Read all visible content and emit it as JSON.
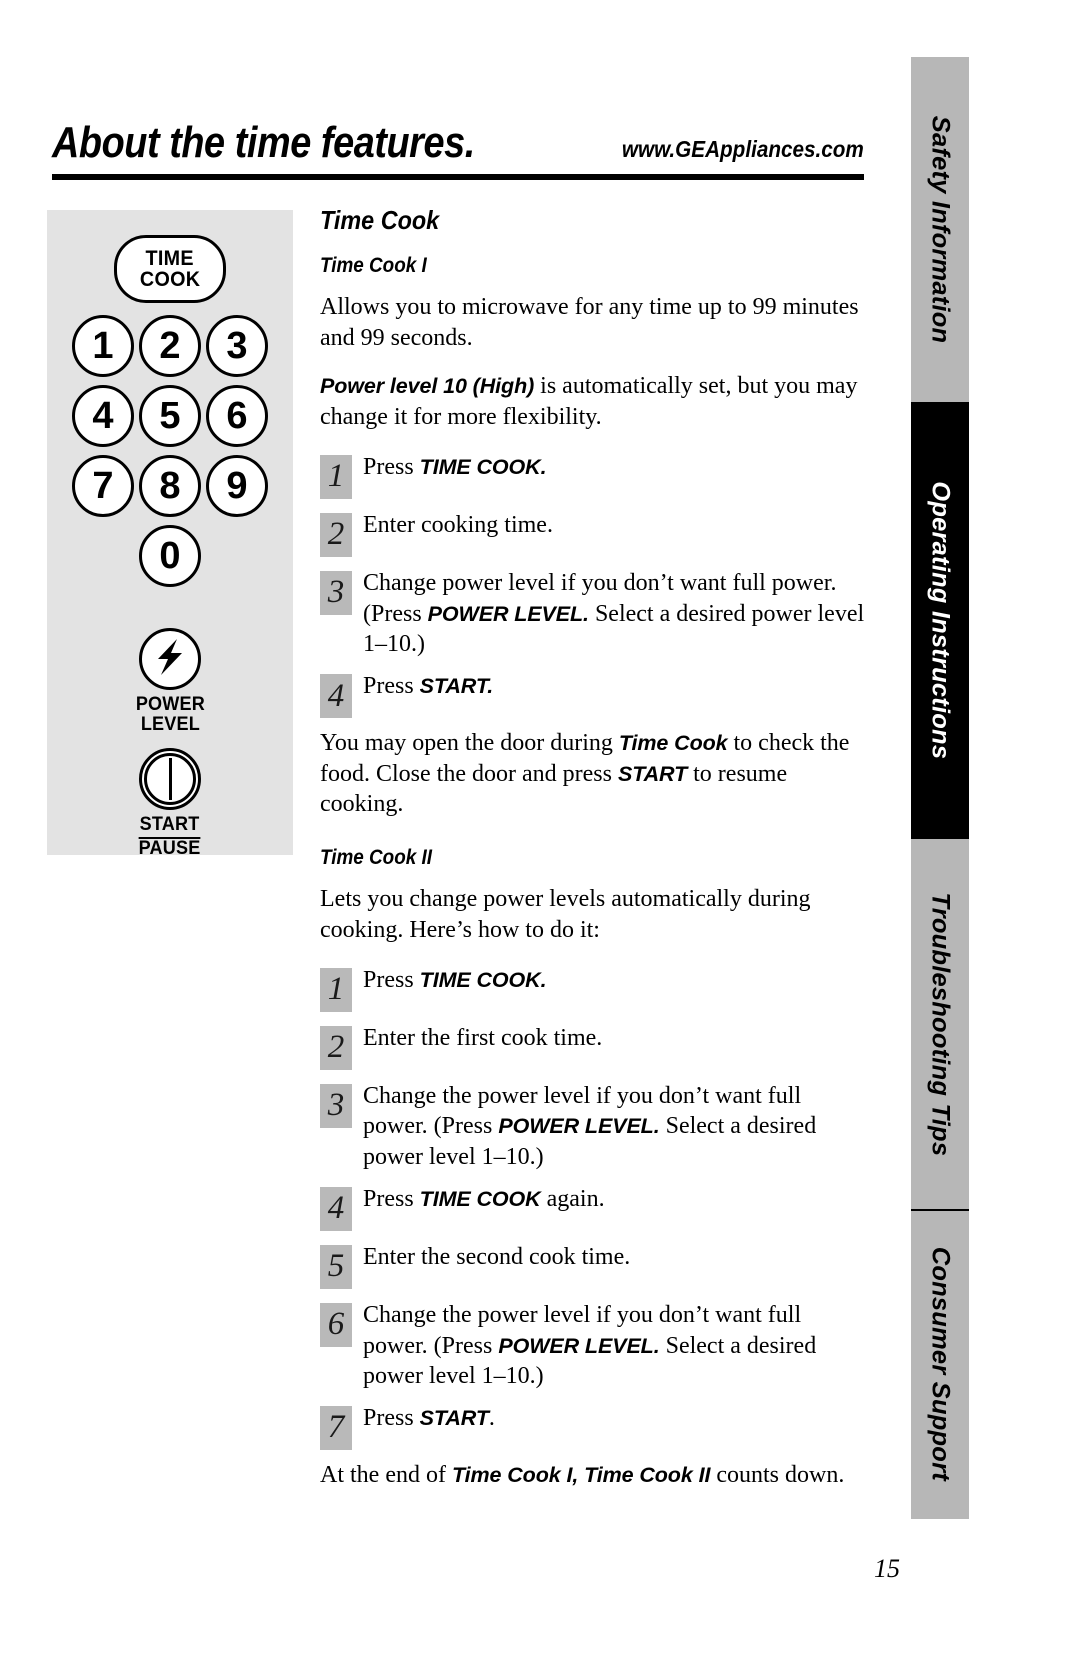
{
  "header": {
    "title": "About the time features.",
    "url": "www.GEAppliances.com"
  },
  "page_number": "15",
  "side_tabs": [
    {
      "label": "Safety Information",
      "active": false
    },
    {
      "label": "Operating Instructions",
      "active": true
    },
    {
      "label": "Troubleshooting Tips",
      "active": false
    },
    {
      "label": "Consumer Support",
      "active": false
    }
  ],
  "keypad": {
    "time_cook_line1": "TIME",
    "time_cook_line2": "COOK",
    "digits": [
      "1",
      "2",
      "3",
      "4",
      "5",
      "6",
      "7",
      "8",
      "9",
      "0"
    ],
    "power_label_line1": "POWER",
    "power_label_line2": "LEVEL",
    "start_label_line1": "START",
    "start_label_line2": "PAUSE"
  },
  "content": {
    "section_title": "Time Cook",
    "time_cook_1": {
      "heading": "Time Cook I",
      "intro": "Allows you to microwave for any time up to 99 minutes and 99 seconds.",
      "power_note_bold": "Power level 10 (High)",
      "power_note_rest": " is automatically set, but you may change it for more flexibility.",
      "steps": [
        {
          "num": "1",
          "pre": "Press ",
          "cmd": "TIME COOK.",
          "post": ""
        },
        {
          "num": "2",
          "pre": "Enter cooking time.",
          "cmd": "",
          "post": ""
        },
        {
          "num": "3",
          "pre": "Change power level if you don’t want full power. (Press ",
          "cmd": "POWER LEVEL.",
          "post": " Select a desired power level 1–10.)"
        },
        {
          "num": "4",
          "pre": "Press ",
          "cmd": "START.",
          "post": ""
        }
      ],
      "note_part1": "You may open the door during ",
      "note_cmd1": "Time Cook",
      "note_part2": " to check the food. Close the door and press ",
      "note_cmd2": "START",
      "note_part3": " to resume cooking."
    },
    "time_cook_2": {
      "heading": "Time Cook II",
      "intro": "Lets you change power levels automatically during cooking. Here’s how to do it:",
      "steps": [
        {
          "num": "1",
          "pre": "Press ",
          "cmd": "TIME COOK.",
          "post": ""
        },
        {
          "num": "2",
          "pre": "Enter the first cook time.",
          "cmd": "",
          "post": ""
        },
        {
          "num": "3",
          "pre": "Change the power level if you don’t want full power. (Press ",
          "cmd": "POWER LEVEL.",
          "post": " Select a desired power level 1–10.)"
        },
        {
          "num": "4",
          "pre": "Press ",
          "cmd": "TIME COOK",
          "post": " again."
        },
        {
          "num": "5",
          "pre": "Enter the second cook time.",
          "cmd": "",
          "post": ""
        },
        {
          "num": "6",
          "pre": "Change the power level if you don’t want full power. (Press ",
          "cmd": "POWER LEVEL.",
          "post": " Select a desired power level 1–10.)"
        },
        {
          "num": "7",
          "pre": "Press ",
          "cmd": "START",
          "post": "."
        }
      ],
      "footer_part1": "At the end of ",
      "footer_cmd": "Time Cook I, Time Cook II",
      "footer_part2": " counts down."
    }
  }
}
